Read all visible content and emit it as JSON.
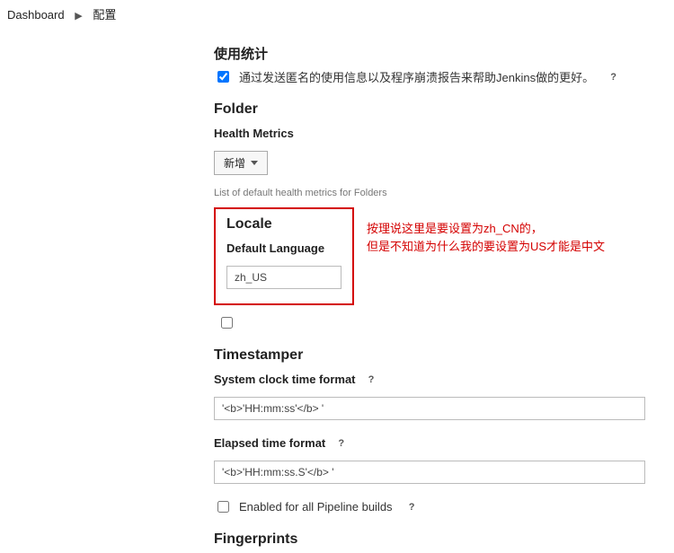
{
  "breadcrumb": {
    "dashboard": "Dashboard",
    "config": "配置"
  },
  "usageStats": {
    "heading": "使用统计",
    "checkbox_label": "通过发送匿名的使用信息以及程序崩溃报告来帮助Jenkins做的更好。"
  },
  "folder": {
    "heading": "Folder",
    "health_metrics": "Health Metrics",
    "add_button": "新增",
    "list_text": "List of default health metrics for Folders"
  },
  "locale": {
    "heading": "Locale",
    "default_language_label": "Default Language",
    "value": "zh_US"
  },
  "annotation": {
    "line1": "按理说这里是要设置为zh_CN的，",
    "line2": "但是不知道为什么我的要设置为US才能是中文"
  },
  "timestamper": {
    "heading": "Timestamper",
    "system_clock_label": "System clock time format",
    "system_clock_value": "'<b>'HH:mm:ss'</b> '",
    "elapsed_label": "Elapsed time format",
    "elapsed_value": "'<b>'HH:mm:ss.S'</b> '",
    "pipeline_label": "Enabled for all Pipeline builds"
  },
  "fingerprints": {
    "heading": "Fingerprints"
  },
  "help": "?"
}
